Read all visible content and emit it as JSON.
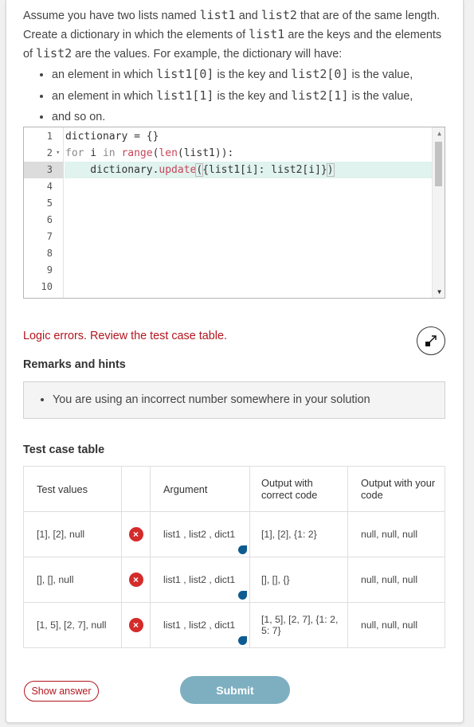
{
  "prompt": {
    "line1_a": "Assume you have two lists named ",
    "code_list1": "list1",
    "line1_b": " and ",
    "code_list2": "list2",
    "line1_c": " that are of the same length. Create a dictionary in which the elements of ",
    "line1_d": " are the keys and the elements of ",
    "line1_e": " are the values. For example, the dictionary will have:",
    "bullet1_a": "an element in which ",
    "bullet1_code1": "list1[0]",
    "bullet1_b": " is the key and ",
    "bullet1_code2": "list2[0]",
    "bullet1_c": " is the value,",
    "bullet2_code1": "list1[1]",
    "bullet2_code2": "list2[1]",
    "bullet3": "and so on."
  },
  "editor": {
    "line_numbers": [
      "1",
      "2",
      "3",
      "4",
      "5",
      "6",
      "7",
      "8",
      "9",
      "10"
    ],
    "fold_marker": "▾",
    "line1": "dictionary = {}",
    "line2_for": "for",
    "line2_i": " i ",
    "line2_in": "in",
    "line2_range": " range",
    "line2_paren": "(",
    "line2_len": "len",
    "line2_rest": "(list1)):",
    "line3_indent": "    dictionary.",
    "line3_update": "update",
    "line3_open": "(",
    "line3_mid": "{list1[i]: list2[i]}",
    "line3_close": ")",
    "scroll_up": "▲",
    "scroll_down": "▼"
  },
  "error_text": "Logic errors. Review the test case table.",
  "remarks_title": "Remarks and hints",
  "hint": "You are using an incorrect number somewhere in your solution",
  "test_case_title": "Test case table",
  "table": {
    "headers": [
      "Test values",
      "",
      "Argument",
      "Output with correct code",
      "Output with your code"
    ],
    "rows": [
      {
        "values": "[1], [2], null",
        "status": "×",
        "argument": "list1 , list2 , dict1",
        "correct": "[1], [2], {1: 2}",
        "yours": "null, null, null"
      },
      {
        "values": "[], [], null",
        "status": "×",
        "argument": "list1 , list2 , dict1",
        "correct": "[], [], {}",
        "yours": "null, null, null"
      },
      {
        "values": "[1, 5], [2, 7], null",
        "status": "×",
        "argument": "list1 , list2 , dict1",
        "correct": "[1, 5], [2, 7], {1: 2, 5: 7}",
        "yours": "null, null, null"
      }
    ]
  },
  "buttons": {
    "show_answer": "Show answer",
    "submit": "Submit"
  },
  "colors": {
    "error": "#b3151e",
    "submit_bg": "#7dafc1",
    "fail_icon": "#d42b2b",
    "active_line": "#e0f3ee"
  }
}
